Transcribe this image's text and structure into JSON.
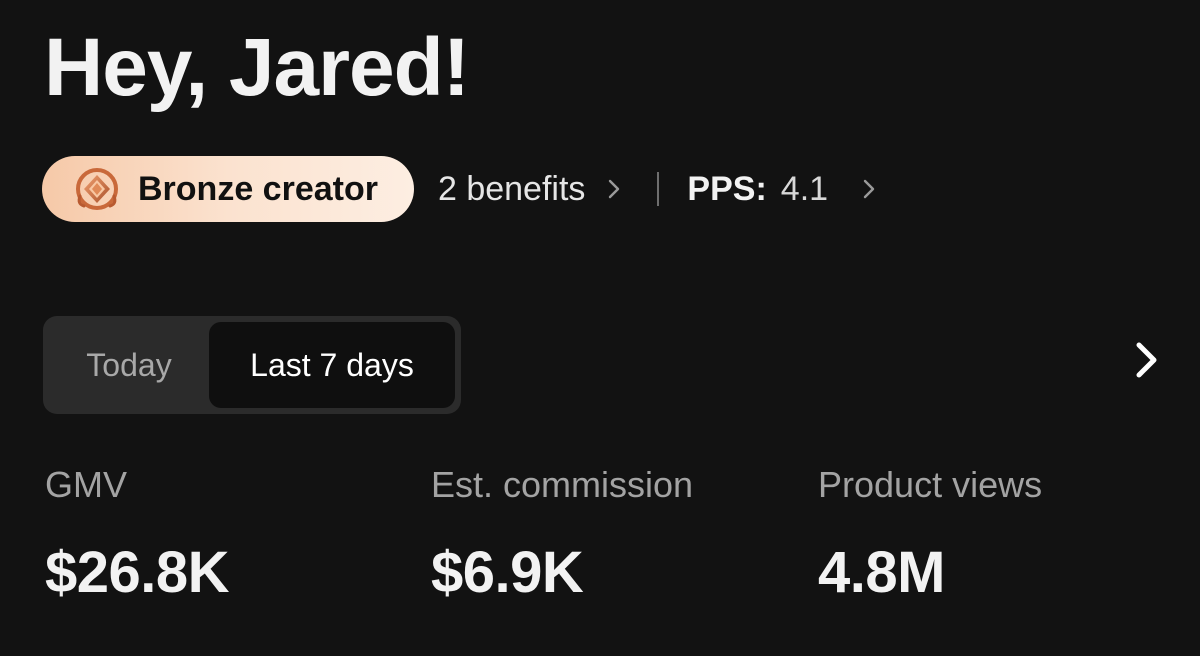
{
  "greeting": "Hey, Jared!",
  "creator_tier": {
    "label": "Bronze creator",
    "icon": "bronze-medal-icon",
    "colors": {
      "badge_gradient_start": "#f6c9a8",
      "badge_gradient_end": "#fdeee2",
      "medal": "#c9693a"
    }
  },
  "benefits": {
    "label": "2 benefits",
    "icon": "chevron-right-icon"
  },
  "pps": {
    "label": "PPS:",
    "value": "4.1",
    "icon": "chevron-right-icon"
  },
  "date_range": {
    "options": [
      "Today",
      "Last 7 days"
    ],
    "selected": "Last 7 days"
  },
  "details_link": {
    "icon": "chevron-right-icon"
  },
  "metrics": [
    {
      "label": "GMV",
      "value": "$26.8K"
    },
    {
      "label": "Est. commission",
      "value": "$6.9K"
    },
    {
      "label": "Product views",
      "value": "4.8M"
    }
  ],
  "colors": {
    "background": "#121212",
    "segment_track": "#2b2b2b",
    "segment_selected": "#0f0f0f",
    "muted_text": "#a3a3a3"
  }
}
